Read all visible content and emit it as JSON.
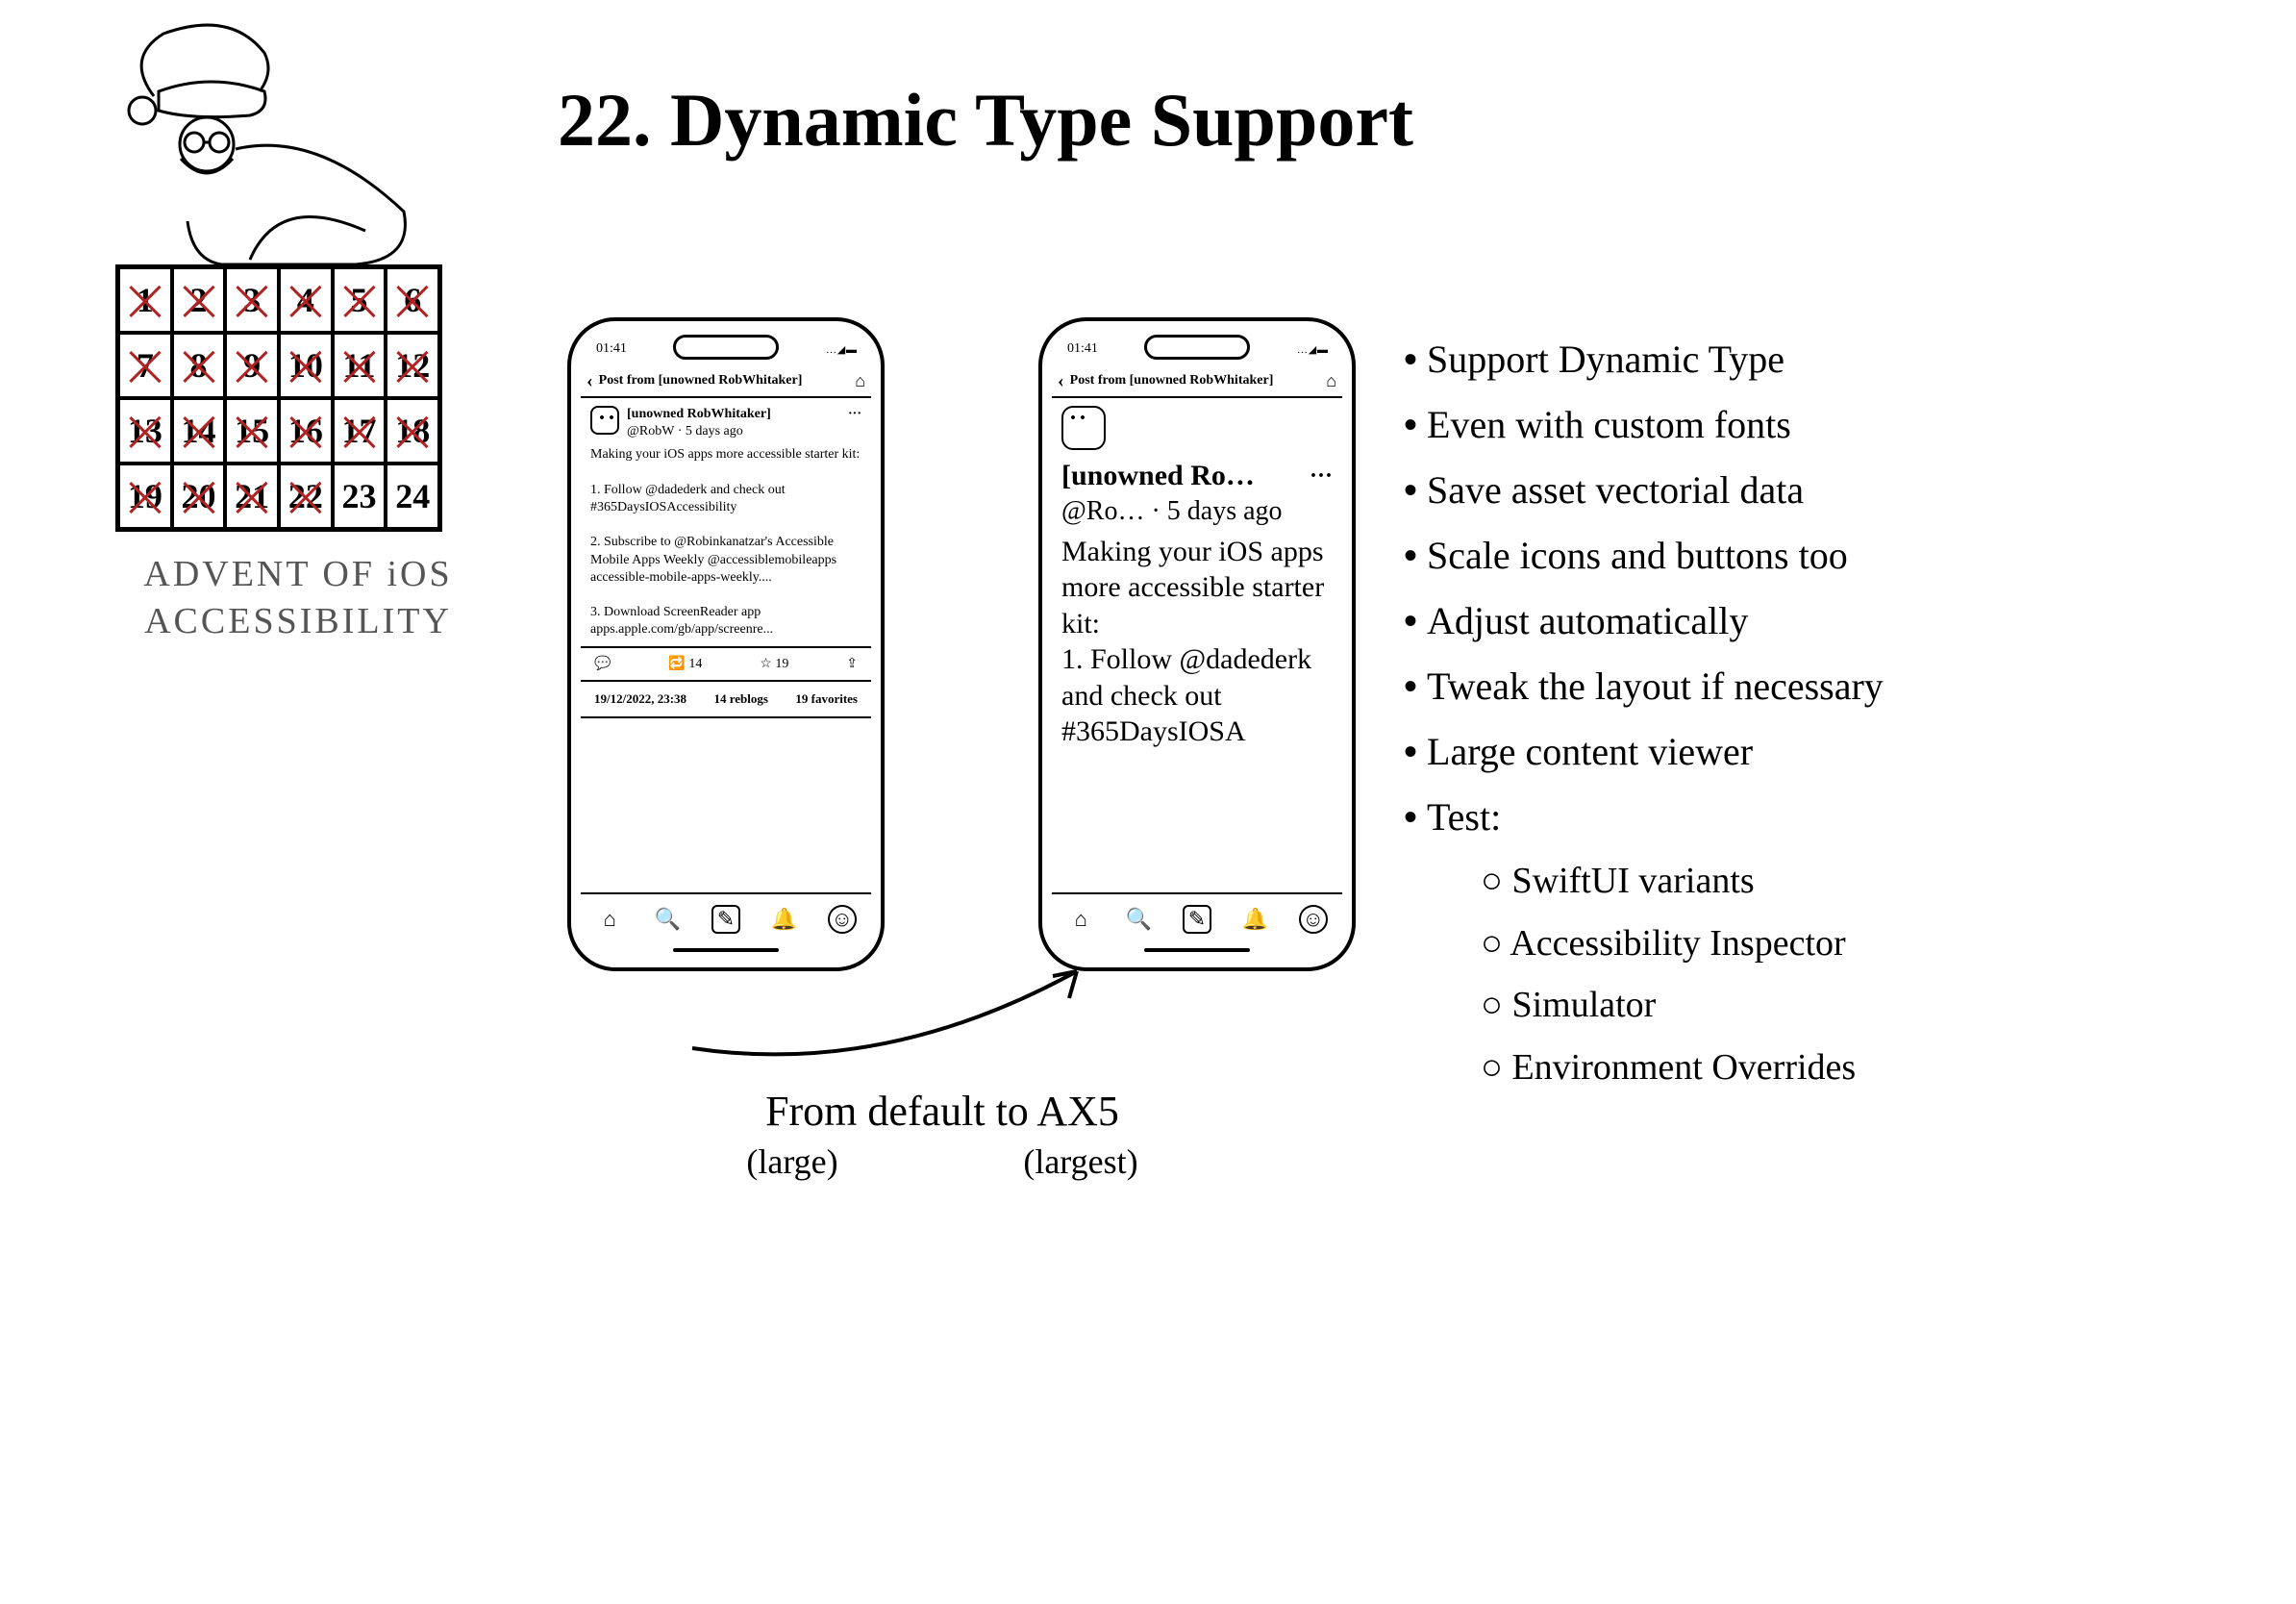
{
  "title": "22. Dynamic Type Support",
  "advent": {
    "caption_line1": "ADVENT OF iOS",
    "caption_line2": "ACCESSIBILITY",
    "days": [
      {
        "n": "1",
        "x": true
      },
      {
        "n": "2",
        "x": true
      },
      {
        "n": "3",
        "x": true
      },
      {
        "n": "4",
        "x": true
      },
      {
        "n": "5",
        "x": true
      },
      {
        "n": "6",
        "x": true
      },
      {
        "n": "7",
        "x": true
      },
      {
        "n": "8",
        "x": true
      },
      {
        "n": "9",
        "x": true
      },
      {
        "n": "10",
        "x": true
      },
      {
        "n": "11",
        "x": true
      },
      {
        "n": "12",
        "x": true
      },
      {
        "n": "13",
        "x": true
      },
      {
        "n": "14",
        "x": true
      },
      {
        "n": "15",
        "x": true
      },
      {
        "n": "16",
        "x": true
      },
      {
        "n": "17",
        "x": true
      },
      {
        "n": "18",
        "x": true
      },
      {
        "n": "19",
        "x": true
      },
      {
        "n": "20",
        "x": true
      },
      {
        "n": "21",
        "x": true
      },
      {
        "n": "22",
        "x": true
      },
      {
        "n": "23",
        "x": false
      },
      {
        "n": "24",
        "x": false
      }
    ]
  },
  "phone_default": {
    "time": "01:41",
    "nav_title": "Post from [unowned RobWhitaker]",
    "user_name": "[unowned RobWhitaker]",
    "user_handle": "@RobW · 5 days ago",
    "body": "Making your iOS apps more accessible starter kit:\n\n1. Follow @dadederk and check out #365DaysIOSAccessibility\n\n2. Subscribe to @Robinkanatzar's Accessible Mobile Apps Weekly @accessiblemobileapps accessible-mobile-apps-weekly....\n\n3. Download ScreenReader app apps.apple.com/gb/app/screenre...",
    "reblogs": "14",
    "favs": "19",
    "timestamp": "19/12/2022, 23:38",
    "reblogs_label": "14 reblogs",
    "favs_label": "19 favorites"
  },
  "phone_large": {
    "time": "01:41",
    "nav_title": "Post from [unowned RobWhitaker]",
    "user_name_trunc": "[unowned Ro…",
    "user_handle_trunc": "@Ro… · 5 days ago",
    "body": "Making your iOS apps more accessible starter kit:\n1. Follow @dadederk and check out #365DaysIOSA"
  },
  "arrow": {
    "line1": "From default to AX5",
    "sub_left": "(large)",
    "sub_right": "(largest)"
  },
  "bullets": {
    "items": [
      "Support Dynamic Type",
      "Even with custom fonts",
      "Save asset vectorial data",
      "Scale icons and buttons too",
      "Adjust automatically",
      "Tweak the layout if necessary",
      "Large content viewer",
      "Test:"
    ],
    "subitems": [
      "SwiftUI variants",
      "Accessibility Inspector",
      "Simulator",
      "Environment Overrides"
    ]
  }
}
